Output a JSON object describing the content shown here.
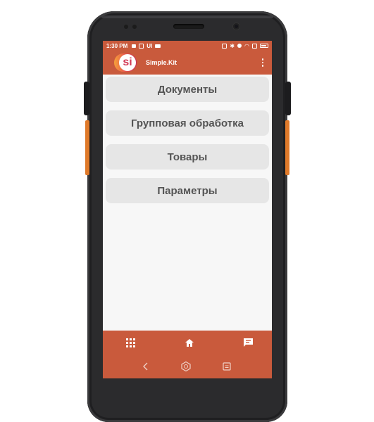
{
  "status_bar": {
    "time": "1:30 PM",
    "left_label": "UI"
  },
  "app_bar": {
    "logo_text": "si",
    "title": "Simple.Kit"
  },
  "menu": {
    "items": [
      {
        "label": "Документы"
      },
      {
        "label": "Групповая обработка"
      },
      {
        "label": "Товары"
      },
      {
        "label": "Параметры"
      }
    ]
  },
  "colors": {
    "accent": "#c95a3c",
    "button_bg": "#e6e6e6",
    "button_text": "#555555",
    "screen_bg": "#f7f7f7"
  },
  "icons": {
    "bottom_nav": [
      "grid-icon",
      "home-icon",
      "chat-icon"
    ],
    "system_nav": [
      "back-icon",
      "home-system-icon",
      "recents-icon"
    ]
  }
}
